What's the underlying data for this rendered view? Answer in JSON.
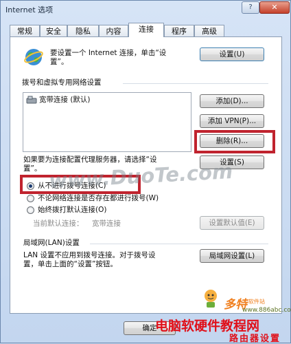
{
  "window": {
    "title": "Internet 选项",
    "help_label": "?",
    "close_label": "✕"
  },
  "tabs": [
    {
      "label": "常规"
    },
    {
      "label": "安全"
    },
    {
      "label": "隐私"
    },
    {
      "label": "内容"
    },
    {
      "label": "连接",
      "active": true
    },
    {
      "label": "程序"
    },
    {
      "label": "高级"
    }
  ],
  "setup": {
    "description_line1": "要设置一个 Internet 连接，单击“设",
    "description_line2": "置”。",
    "button": "设置(U)"
  },
  "dialup": {
    "section_title": "拨号和虚拟专用网络设置",
    "connections": [
      {
        "label": "宽带连接 (默认)"
      }
    ],
    "add_button": "添加(D)...",
    "add_vpn_button": "添加 VPN(P)...",
    "delete_button": "删除(R)...",
    "settings_button": "设置(S)",
    "proxy_hint_line1": "如果要为连接配置代理服务器，请选择“设",
    "proxy_hint_line2": "置”。",
    "options": [
      {
        "label": "从不进行拨号连接(C)",
        "checked": true
      },
      {
        "label": "不论网络连接是否存在都进行拨号(W)",
        "checked": false
      },
      {
        "label": "始终拨打默认连接(O)",
        "checked": false
      }
    ],
    "current_default_label": "当前默认连接：",
    "current_default_value": "宽带连接",
    "set_default_button": "设置默认值(E)"
  },
  "lan": {
    "section_title": "局域网(LAN)设置",
    "description_line1": "LAN 设置不应用到拨号连接。对于拨号设",
    "description_line2": "置，单击上面的“设置”按钮。",
    "button": "局域网设置(L)"
  },
  "footer": {
    "ok_button": "确定"
  },
  "watermarks": {
    "center": "www.DuoTe.com",
    "brand": "多特",
    "brand_sub": "软件站",
    "site": "www.886abc.com",
    "red_title": "电脑软硬件教程网",
    "red_sub": "路由器设置"
  },
  "colors": {
    "highlight": "#c0232e",
    "watermark_red": "#e0101a",
    "watermark_orange": "#f08020"
  }
}
